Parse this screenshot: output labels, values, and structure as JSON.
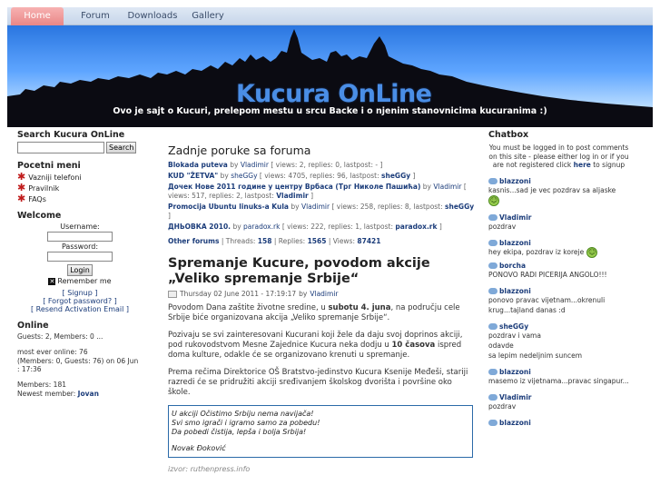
{
  "nav": {
    "items": [
      {
        "label": "Home",
        "active": true
      },
      {
        "label": "Forum"
      },
      {
        "label": "Downloads"
      },
      {
        "label": "Gallery"
      }
    ]
  },
  "banner": {
    "title": "Kucura OnLine",
    "subtitle": "Ovo je sajt o Kucuri, prelepom mestu u srcu Backe i o njenim stanovnicima kucuranima :)"
  },
  "search": {
    "heading": "Search Kucura OnLine",
    "button": "Search",
    "value": ""
  },
  "menu": {
    "heading": "Pocetni meni",
    "items": [
      "Vazniji telefoni",
      "Pravilnik",
      "FAQs"
    ]
  },
  "login": {
    "heading": "Welcome",
    "username_label": "Username:",
    "password_label": "Password:",
    "button": "Login",
    "remember": "Remember me",
    "signup": "[ Signup ]",
    "forgot": "[ Forgot password? ]",
    "resend": "[ Resend Activation Email ]"
  },
  "online": {
    "heading": "Online",
    "guests_line": "Guests: 2, Members: 0 ...",
    "most_ever_1": "most ever online: 76",
    "most_ever_2": "(Members: 0, Guests: 76) on 06 Jun : 17:36",
    "members": "Members: 181",
    "newest_label": "Newest member: ",
    "newest_name": "Jovan"
  },
  "forum": {
    "heading": "Zadnje poruke sa foruma",
    "posts": [
      {
        "title": "Blokada puteva",
        "by": "by",
        "author": "Vladimir",
        "stats": "[ views: 2, replies: 0, lastpost: - ]",
        "last": ""
      },
      {
        "title": "KUD \"ŽETVA\"",
        "by": "by",
        "author": "sheGGy",
        "stats": "[ views: 4705, replies: 96, lastpost: ",
        "last": "sheGGy",
        "end": " ]"
      },
      {
        "title": "Дочек Нове 2011 године у центру Врбаса (Трг Николе Пашића)",
        "by": "by",
        "author": "Vladimir",
        "stats": "[ views: 517, replies: 2, lastpost: ",
        "last": "Vladimir",
        "end": " ]"
      },
      {
        "title": "Promocija Ubuntu linuks-a Kula",
        "by": "by",
        "author": "Vladimir",
        "stats": "[ views: 258, replies: 8, lastpost: ",
        "last": "sheGGy",
        "end": " ]"
      },
      {
        "title": "ДНЬОВКА 2010.",
        "by": "by",
        "author": "paradox.rk",
        "stats": "[ views: 222, replies: 1, lastpost: ",
        "last": "paradox.rk",
        "end": " ]"
      }
    ],
    "other_label": "Other forums",
    "threads_label": " | Threads: ",
    "threads": "158",
    "replies_label": " | Replies: ",
    "replies": "1565",
    "views_label": " | Views: ",
    "views": "87421"
  },
  "article": {
    "title": "Spremanje Kucure, povodom akcije „Veliko spremanje Srbije“",
    "date": "Thursday 02 June 2011 - 17:19:17",
    "by": "by",
    "author": "Vladimir",
    "p1_a": "Povodom Dana zaštite životne sredine, u ",
    "p1_b": "subotu 4. juna",
    "p1_c": ", na području cele Srbije biće organizovana akcija „Veliko spremanje Srbije“.",
    "p2_a": "Pozivaju se svi zainteresovani Kucurani koji žele da daju svoj doprinos akciji, pod rukovodstvom Mesne Zajednice Kucura neka dodju u ",
    "p2_b": "10 časova",
    "p2_c": " ispred doma kulture, odakle će se organizovano krenuti u spremanje.",
    "p3": "Prema rečima Direktorice OŠ Bratstvo-jedinstvo Kucura Ksenije Međeši, stariji razredi će se pridružiti akciji sređivanjem školskog dvorišta i površine oko škole.",
    "quote_1": "U akciji Očistimo Srbiju nema navijača!",
    "quote_2": "Svi smo igrači i igramo samo za pobedu!",
    "quote_3": "Da pobedi čistija, lepša i bolja Srbija!",
    "quote_sign": "Novak Đoković",
    "source": "izvor: ruthenpress.info"
  },
  "chatbox": {
    "heading": "Chatbox",
    "note_1": "You must be logged in to post comments on this site - please either log in or if you are not registered click ",
    "note_here": "here",
    "note_2": " to signup",
    "messages": [
      {
        "user": "blazzoni",
        "text": "kasnis...sad je vec pozdrav sa aljaske",
        "smile": true
      },
      {
        "user": "Vladimir",
        "text": "pozdrav"
      },
      {
        "user": "blazzoni",
        "text": "hey ekipa, pozdrav iz koreje",
        "smile": true
      },
      {
        "user": "borcha",
        "text": "PONOVO RADI PICERIJA ANGOLO!!!"
      },
      {
        "user": "blazzoni",
        "text": "ponovo pravac vijetnam...okrenuli krug...tajland danas :d"
      },
      {
        "user": "sheGGy",
        "text": "pozdrav i vama",
        "text2": "odavde",
        "text3": "sa lepim nedeljnim suncem"
      },
      {
        "user": "blazzoni",
        "text": "masemo iz vijetnama...pravac singapur..."
      },
      {
        "user": "Vladimir",
        "text": "pozdrav"
      },
      {
        "user": "blazzoni",
        "text": ""
      }
    ]
  },
  "colors": {
    "accent_link": "#1b3c7a",
    "nav_active": "#e98787",
    "banner_sky": "#5ea5ff",
    "star": "#c01b1b"
  }
}
